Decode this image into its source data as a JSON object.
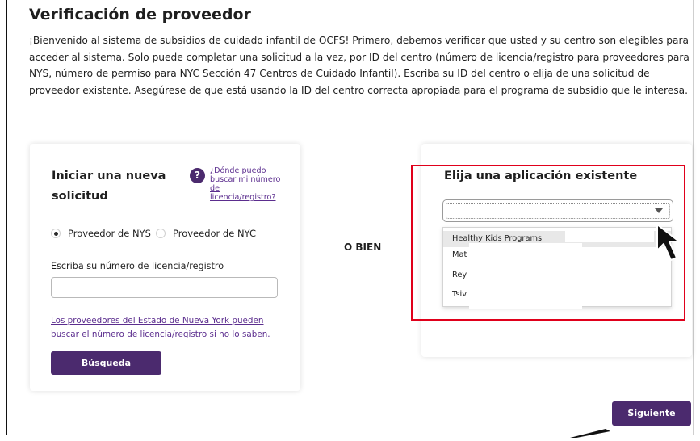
{
  "page": {
    "title": "Verificación de proveedor",
    "intro": "¡Bienvenido al sistema de subsidios de cuidado infantil de OCFS! Primero, debemos verificar que usted y su centro son elegibles para acceder al sistema. Solo puede completar una solicitud a la vez, por ID del centro (número de licencia/registro para proveedores para NYS, número de permiso para NYC Sección 47 Centros de Cuidado Infantil). Escriba su ID del centro o elija de una solicitud de proveedor existente. Asegúrese de que está usando la ID del centro correcta apropiada para el programa de subsidio que le interesa."
  },
  "new_application": {
    "title": "Iniciar una nueva solicitud",
    "help_icon": "question-mark-icon",
    "help_link": "¿Dónde puedo buscar mi número de licencia/registro?",
    "radio_options": [
      {
        "label": "Proveedor de NYS",
        "checked": true
      },
      {
        "label": "Proveedor de NYC",
        "checked": false
      }
    ],
    "license_label": "Escriba su número de licencia/registro",
    "license_value": "",
    "nys_note_link": "Los proveedores del Estado de Nueva York pueden buscar el número de licencia/registro si no lo saben.",
    "search_button": "Búsqueda"
  },
  "separator": "O BIEN",
  "existing_application": {
    "title": "Elija una aplicación existente",
    "selected_value": "",
    "options": [
      "Healthy Kids Programs",
      "Mat",
      "Rey",
      "Tsiv"
    ],
    "caret_icon": "caret-down-icon"
  },
  "footer": {
    "next_button": "Siguiente"
  },
  "colors": {
    "primary": "#4b2a6e",
    "link": "#5b2d8e",
    "highlight": "#e0001b"
  }
}
